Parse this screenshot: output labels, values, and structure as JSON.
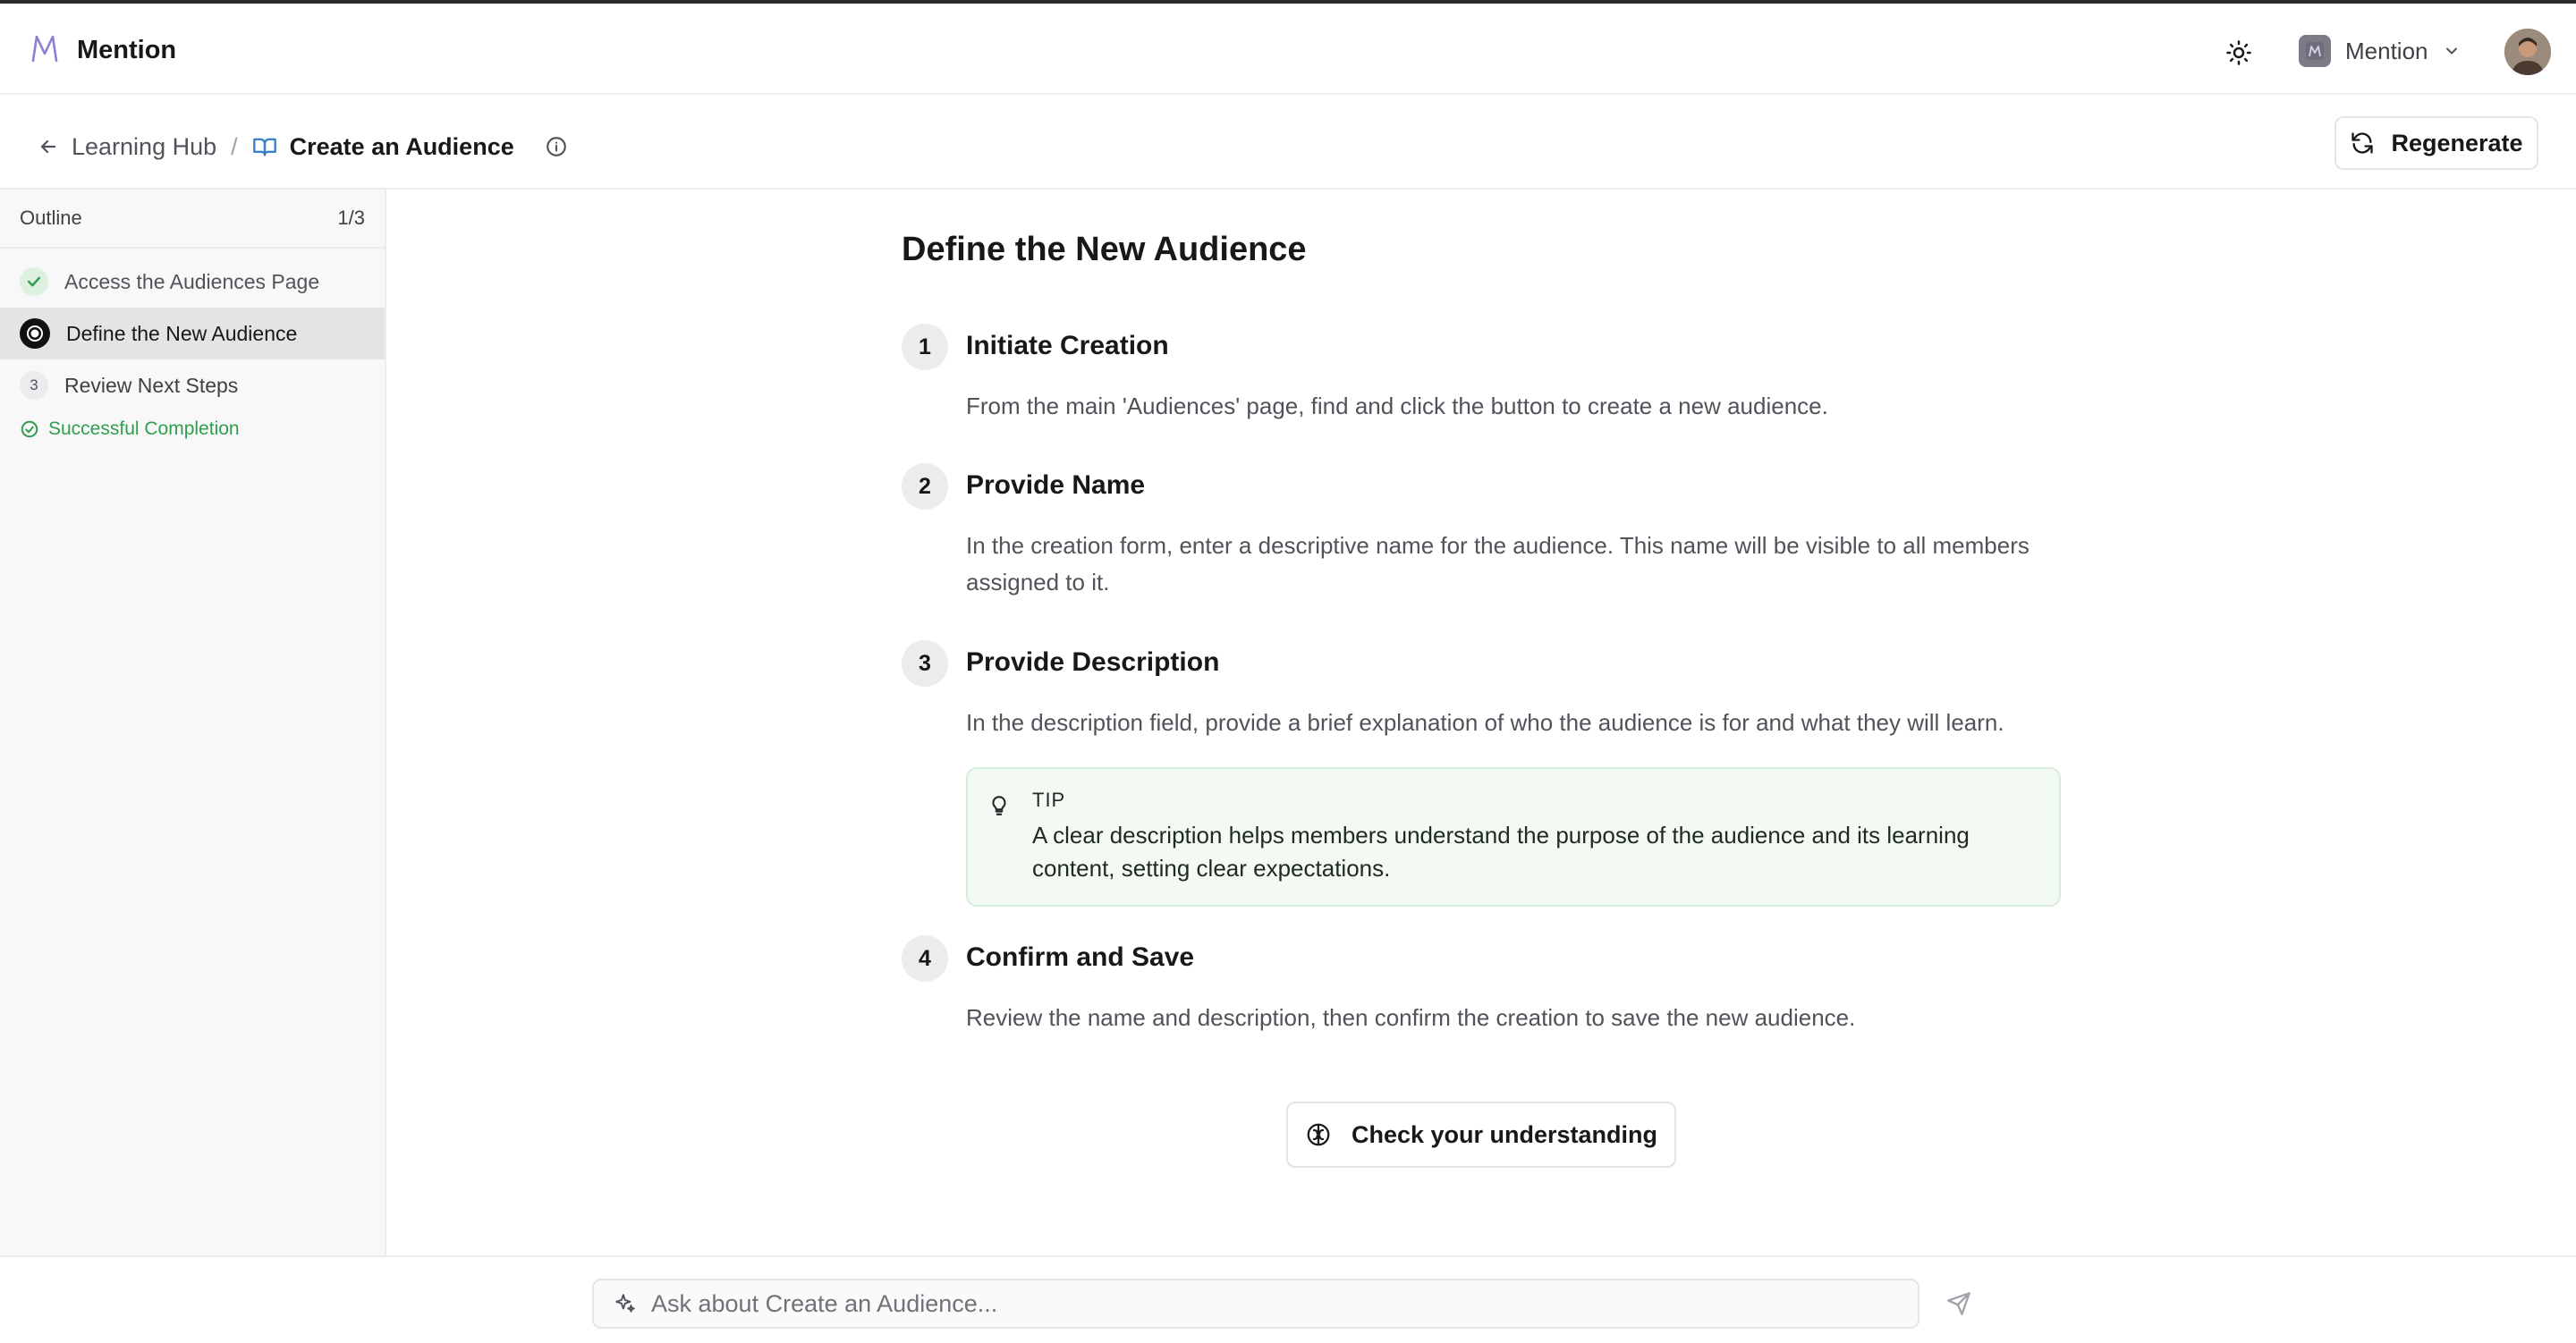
{
  "app": {
    "name": "Mention"
  },
  "topbar": {
    "theme_icon": "sun-icon",
    "workspace_name": "Mention",
    "workspace_icon": "workspace-logo",
    "dropdown_icon": "chevron-down-icon"
  },
  "breadcrumb": {
    "parent": "Learning Hub",
    "separator": "/",
    "current": "Create an Audience"
  },
  "toolbar": {
    "regenerate_label": "Regenerate"
  },
  "sidebar": {
    "heading": "Outline",
    "progress": "1/3",
    "items": [
      {
        "label": "Access the Audiences Page",
        "state": "done"
      },
      {
        "label": "Define the New Audience",
        "state": "active"
      },
      {
        "label": "Review Next Steps",
        "state": "todo",
        "number": "3"
      }
    ],
    "completion": "Successful Completion"
  },
  "main": {
    "title": "Define the New Audience",
    "steps": [
      {
        "number": "1",
        "title": "Initiate Creation",
        "body": "From the main 'Audiences' page, find and click the button to create a new audience."
      },
      {
        "number": "2",
        "title": "Provide Name",
        "body": "In the creation form, enter a descriptive name for the audience. This name will be visible to all members assigned to it."
      },
      {
        "number": "3",
        "title": "Provide Description",
        "body": "In the description field, provide a brief explanation of who the audience is for and what they will learn."
      },
      {
        "number": "4",
        "title": "Confirm and Save",
        "body": "Review the name and description, then confirm the creation to save the new audience."
      }
    ],
    "tip": {
      "label": "TIP",
      "text": "A clear description helps members understand the purpose of the audience and its learning content, setting clear expectations."
    },
    "check_button": "Check your understanding"
  },
  "ask": {
    "placeholder": "Ask about Create an Audience..."
  },
  "colors": {
    "success": "#2f9e4f",
    "tip_bg": "#f3faf4",
    "active_bg": "#e4e4e6",
    "brand_logo": "#8b7fd6"
  }
}
